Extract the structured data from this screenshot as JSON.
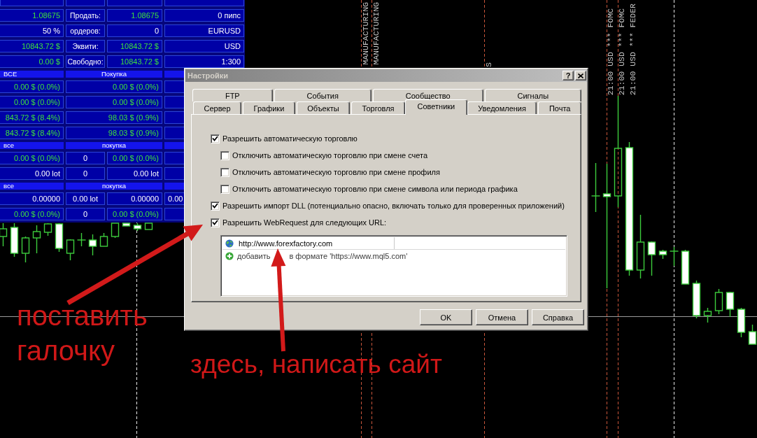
{
  "account_panel": {
    "rows": [
      {
        "kind": "data",
        "cells": [
          {
            "text": "1.08675",
            "kind": "value"
          },
          {
            "text": "Продать:",
            "kind": "label"
          },
          {
            "text": "1.08675",
            "kind": "value"
          },
          {
            "text": "0 пипс",
            "kind": "plain"
          }
        ]
      },
      {
        "kind": "data",
        "cells": [
          {
            "text": "50 %",
            "kind": "plain"
          },
          {
            "text": "ордеров:",
            "kind": "label"
          },
          {
            "text": "0",
            "kind": "plain"
          },
          {
            "text": "EURUSD",
            "kind": "plain"
          }
        ]
      },
      {
        "kind": "data",
        "cells": [
          {
            "text": "10843.72 $",
            "kind": "value"
          },
          {
            "text": "Эквити:",
            "kind": "label"
          },
          {
            "text": "10843.72 $",
            "kind": "value"
          },
          {
            "text": "USD",
            "kind": "plain"
          }
        ]
      },
      {
        "kind": "data",
        "cells": [
          {
            "text": "0.00 $",
            "kind": "value"
          },
          {
            "text": "Свободно:",
            "kind": "label"
          },
          {
            "text": "10843.72 $",
            "kind": "value"
          },
          {
            "text": "1:300",
            "kind": "plain"
          }
        ]
      },
      {
        "kind": "header",
        "cells": [
          {
            "text": "ВСЕ"
          },
          {
            "text": "Покупка"
          }
        ]
      },
      {
        "kind": "summary",
        "cells": [
          {
            "text": "0.00 $ (0.0%)",
            "kind": "value"
          },
          {
            "text": "0.00 $ (0.0%)",
            "kind": "value"
          }
        ]
      },
      {
        "kind": "summary",
        "cells": [
          {
            "text": "0.00 $ (0.0%)",
            "kind": "value"
          },
          {
            "text": "0.00 $ (0.0%)",
            "kind": "value"
          }
        ]
      },
      {
        "kind": "summary",
        "cells": [
          {
            "text": "843.72 $ (8.4%)",
            "kind": "value"
          },
          {
            "text": "98.03 $ (0.9%)",
            "kind": "value"
          }
        ]
      },
      {
        "kind": "summary",
        "cells": [
          {
            "text": "843.72 $ (8.4%)",
            "kind": "value"
          },
          {
            "text": "98.03 $ (0.9%)",
            "kind": "value"
          }
        ]
      },
      {
        "kind": "header",
        "cells": [
          {
            "text": "все"
          },
          {
            "text": "покупка"
          }
        ]
      },
      {
        "kind": "stat",
        "cells": [
          {
            "text": "0.00 $ (0.0%)",
            "kind": "value"
          },
          {
            "text": "0",
            "kind": "plain"
          },
          {
            "text": "0.00 $ (0.0%)",
            "kind": "value"
          }
        ]
      },
      {
        "kind": "stat",
        "cells": [
          {
            "text": "0.00 lot",
            "kind": "plain"
          },
          {
            "text": "0",
            "kind": "plain"
          },
          {
            "text": "0.00 lot",
            "kind": "plain"
          }
        ]
      },
      {
        "kind": "header",
        "cells": [
          {
            "text": "все"
          },
          {
            "text": "покупка"
          }
        ]
      },
      {
        "kind": "stat",
        "cells": [
          {
            "text": "0.00000",
            "kind": "plain"
          },
          {
            "text": "0.00 lot",
            "kind": "plain"
          },
          {
            "text": "0.00000",
            "kind": "plain"
          },
          {
            "text": "0.00",
            "kind": "plain"
          }
        ]
      },
      {
        "kind": "stat",
        "cells": [
          {
            "text": "0.00 $ (0.0%)",
            "kind": "value"
          },
          {
            "text": "0",
            "kind": "plain"
          },
          {
            "text": "0.00 $ (0.0%)",
            "kind": "value"
          }
        ]
      }
    ]
  },
  "chart": {
    "event_labels": [
      "MANUFACTURING",
      "MANUFACTURING",
      "S",
      "21:00 USD *** FOMC",
      "21:00 USD *** FOMC",
      "21:00 USD *** FEDER"
    ]
  },
  "dialog": {
    "title": "Настройки",
    "help_button": "?",
    "tab_rows": [
      {
        "tabs": [
          {
            "label": "FTP",
            "selected": false
          },
          {
            "label": "События",
            "selected": false
          },
          {
            "label": "Сообщество",
            "selected": false
          },
          {
            "label": "Сигналы",
            "selected": false
          }
        ]
      },
      {
        "tabs": [
          {
            "label": "Сервер",
            "selected": false
          },
          {
            "label": "Графики",
            "selected": false
          },
          {
            "label": "Объекты",
            "selected": false
          },
          {
            "label": "Торговля",
            "selected": false
          },
          {
            "label": "Советники",
            "selected": true
          },
          {
            "label": "Уведомления",
            "selected": false
          },
          {
            "label": "Почта",
            "selected": false
          }
        ]
      }
    ],
    "options": [
      {
        "label": "Разрешить автоматическую торговлю",
        "checked": true,
        "children": [
          {
            "label": "Отключить автоматическую торговлю при смене счета",
            "checked": false
          },
          {
            "label": "Отключить автоматическую торговлю при смене профиля",
            "checked": false
          },
          {
            "label": "Отключить автоматическую торговлю при смене символа или периода графика",
            "checked": false
          }
        ]
      },
      {
        "label": "Разрешить импорт DLL (потенциально опасно, включать только для проверенных приложений)",
        "checked": true
      },
      {
        "label": "Разрешить WebRequest для следующих URL:",
        "checked": true
      }
    ],
    "url_list": [
      {
        "kind": "url",
        "parts": [
          "http://www.forexfactory.com"
        ]
      },
      {
        "kind": "add",
        "parts": [
          "добавить",
          "в формате 'https://www.mql5.com'"
        ]
      }
    ],
    "buttons": [
      "OK",
      "Отмена",
      "Справка"
    ]
  },
  "annotations": [
    "поставить галочку",
    "здесь, написать сайт"
  ]
}
